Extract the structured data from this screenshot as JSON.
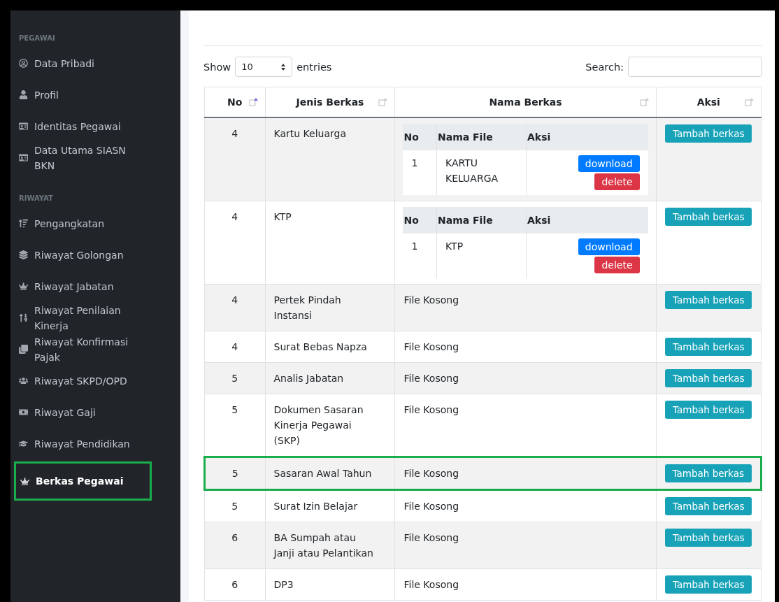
{
  "sidebar": {
    "sections": [
      {
        "heading": "PEGAWAI",
        "items": [
          {
            "label": "Data Pribadi",
            "selected": false,
            "highlighted": false
          },
          {
            "label": "Profil",
            "selected": false,
            "highlighted": false
          },
          {
            "label": "Identitas Pegawai",
            "selected": false,
            "highlighted": false
          },
          {
            "label": "Data Utama SIASN BKN",
            "selected": false,
            "highlighted": false
          }
        ]
      },
      {
        "heading": "RIWAYAT",
        "items": [
          {
            "label": "Pengangkatan",
            "selected": false,
            "highlighted": false
          },
          {
            "label": "Riwayat Golongan",
            "selected": false,
            "highlighted": false
          },
          {
            "label": "Riwayat Jabatan",
            "selected": false,
            "highlighted": false
          },
          {
            "label": "Riwayat Penilaian Kinerja",
            "selected": false,
            "highlighted": false
          },
          {
            "label": "Riwayat Konfirmasi Pajak",
            "selected": false,
            "highlighted": false
          },
          {
            "label": "Riwayat SKPD/OPD",
            "selected": false,
            "highlighted": false
          },
          {
            "label": "Riwayat Gaji",
            "selected": false,
            "highlighted": false
          },
          {
            "label": "Riwayat Pendidikan",
            "selected": false,
            "highlighted": false
          },
          {
            "label": "Berkas Pegawai",
            "selected": true,
            "highlighted": true
          }
        ]
      }
    ]
  },
  "controls": {
    "show_label": "Show",
    "page_size": "10",
    "entries_label": "entries",
    "search_label": "Search:"
  },
  "table": {
    "columns": [
      {
        "label": "No",
        "sorted": true
      },
      {
        "label": "Jenis Berkas",
        "sorted": false
      },
      {
        "label": "Nama Berkas",
        "sorted": false
      },
      {
        "label": "Aksi",
        "sorted": false
      }
    ],
    "rows": [
      {
        "no": "4",
        "jenis": "Kartu Keluarga",
        "highlighted": false,
        "files": {
          "columns": [
            "No",
            "Nama File",
            "Aksi"
          ],
          "rows": [
            {
              "no": "1",
              "name": "KARTU KELUARGA",
              "download": "download",
              "delete": "delete"
            }
          ]
        },
        "action": "Tambah berkas"
      },
      {
        "no": "4",
        "jenis": "KTP",
        "highlighted": false,
        "files": {
          "columns": [
            "No",
            "Nama File",
            "Aksi"
          ],
          "rows": [
            {
              "no": "1",
              "name": "KTP",
              "download": "download",
              "delete": "delete"
            }
          ]
        },
        "action": "Tambah berkas"
      },
      {
        "no": "4",
        "jenis": "Pertek Pindah Instansi",
        "highlighted": false,
        "empty": "File Kosong",
        "action": "Tambah berkas"
      },
      {
        "no": "4",
        "jenis": "Surat Bebas Napza",
        "highlighted": false,
        "empty": "File Kosong",
        "action": "Tambah berkas"
      },
      {
        "no": "5",
        "jenis": "Analis Jabatan",
        "highlighted": false,
        "empty": "File Kosong",
        "action": "Tambah berkas"
      },
      {
        "no": "5",
        "jenis": "Dokumen Sasaran Kinerja Pegawai (SKP)",
        "highlighted": false,
        "empty": "File Kosong",
        "action": "Tambah berkas"
      },
      {
        "no": "5",
        "jenis": "Sasaran Awal Tahun",
        "highlighted": true,
        "empty": "File Kosong",
        "action": "Tambah berkas"
      },
      {
        "no": "5",
        "jenis": "Surat Izin Belajar",
        "highlighted": false,
        "empty": "File Kosong",
        "action": "Tambah berkas"
      },
      {
        "no": "6",
        "jenis": "BA Sumpah atau Janji atau Pelantikan",
        "highlighted": false,
        "empty": "File Kosong",
        "action": "Tambah berkas"
      },
      {
        "no": "6",
        "jenis": "DP3",
        "highlighted": false,
        "empty": "File Kosong",
        "action": "Tambah berkas"
      }
    ]
  }
}
